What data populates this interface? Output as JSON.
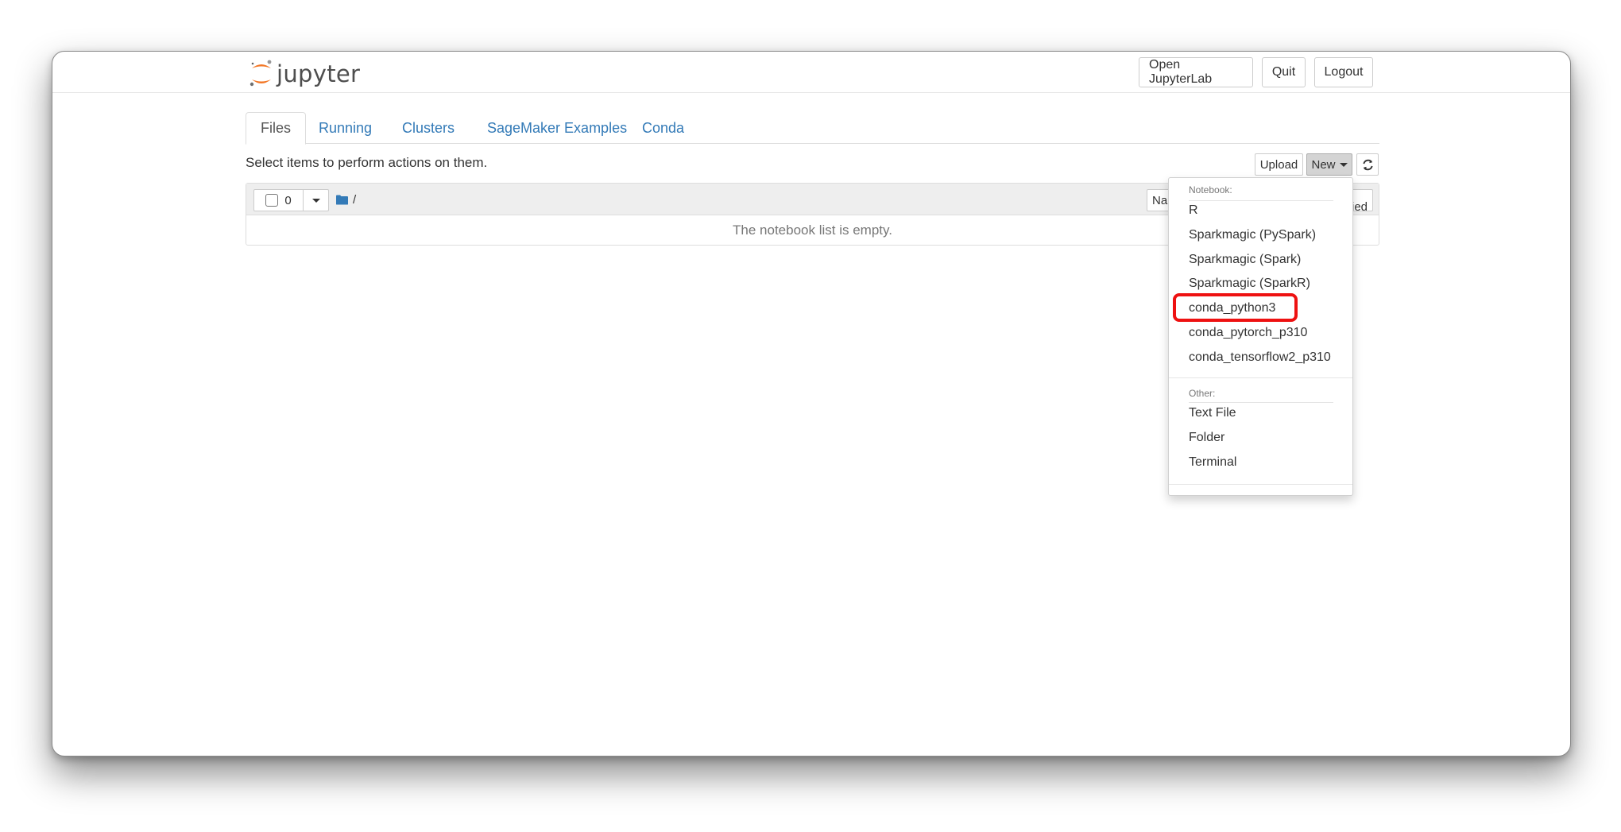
{
  "header": {
    "logo_text": "jupyter",
    "open_jupyterlab_label": "Open JupyterLab",
    "quit_label": "Quit",
    "logout_label": "Logout"
  },
  "tabs": [
    {
      "label": "Files",
      "active": true
    },
    {
      "label": "Running",
      "active": false
    },
    {
      "label": "Clusters",
      "active": false
    },
    {
      "label": "SageMaker Examples",
      "active": false
    },
    {
      "label": "Conda",
      "active": false
    }
  ],
  "toolbar": {
    "hint": "Select items to perform actions on them.",
    "upload_label": "Upload",
    "new_label": "New",
    "refresh_icon": "refresh-icon"
  },
  "file_list": {
    "selected_count": "0",
    "breadcrumb": "/",
    "name_sort_label": "Name",
    "size_sort_label": "Last Modified",
    "empty_message": "The notebook list is empty."
  },
  "new_menu": {
    "notebook_header": "Notebook:",
    "notebook_items": [
      "R",
      "Sparkmagic (PySpark)",
      "Sparkmagic (Spark)",
      "Sparkmagic (SparkR)",
      "conda_python3",
      "conda_pytorch_p310",
      "conda_tensorflow2_p310"
    ],
    "other_header": "Other:",
    "other_items": [
      "Text File",
      "Folder",
      "Terminal"
    ],
    "highlighted_item": "conda_python3"
  },
  "colors": {
    "link": "#337ab7",
    "highlight": "#ee1111",
    "logo_orange": "#f37726"
  }
}
